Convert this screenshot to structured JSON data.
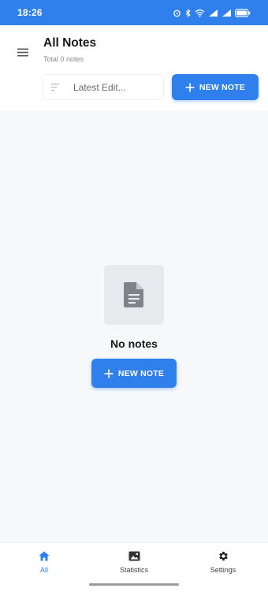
{
  "status_bar": {
    "time": "18:26",
    "icons": [
      "alarm-icon",
      "bluetooth-icon",
      "wifi-icon",
      "signal-icon",
      "signal-icon",
      "battery-icon"
    ]
  },
  "header": {
    "title": "All Notes",
    "subtitle": "Total 0 notes",
    "sort_label": "Latest Edit...",
    "new_note_label": "NEW NOTE",
    "menu_icon": "hamburger-icon"
  },
  "empty_state": {
    "icon": "document-icon",
    "title": "No notes",
    "new_note_label": "NEW NOTE"
  },
  "bottom_nav": {
    "items": [
      {
        "label": "All",
        "icon": "home-icon",
        "active": true
      },
      {
        "label": "Statistics",
        "icon": "image-icon",
        "active": false
      },
      {
        "label": "Settings",
        "icon": "gear-icon",
        "active": false
      }
    ]
  },
  "colors": {
    "accent": "#2f80ed",
    "background": "#f7f8fa",
    "surface": "#ffffff"
  }
}
